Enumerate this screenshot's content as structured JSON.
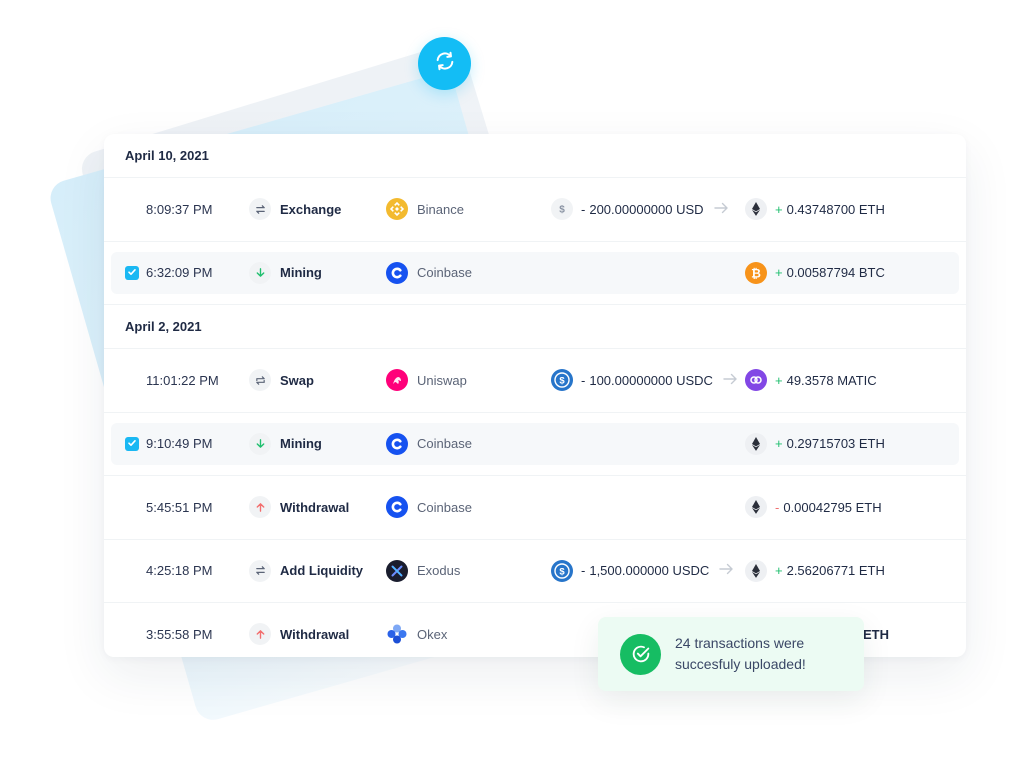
{
  "refresh_button": {
    "icon": "refresh-icon",
    "color": "#13bdf5"
  },
  "groups": [
    {
      "date": "April 10, 2021",
      "rows": [
        {
          "selected": false,
          "time": "8:09:37 PM",
          "type": {
            "label": "Exchange",
            "icon": "exchange-icon"
          },
          "exchange": {
            "name": "Binance",
            "icon": "binance-logo",
            "color": "#f3ba2f"
          },
          "sent": {
            "sign": "-",
            "amount": "200.00000000 USD",
            "icon": "dollar-icon"
          },
          "received": {
            "sign": "+",
            "amount": "0.43748700 ETH",
            "icon": "ethereum-icon"
          }
        },
        {
          "selected": true,
          "time": "6:32:09 PM",
          "type": {
            "label": "Mining",
            "icon": "arrow-down-icon"
          },
          "exchange": {
            "name": "Coinbase",
            "icon": "coinbase-logo",
            "color": "#1652f0"
          },
          "sent": null,
          "received": {
            "sign": "+",
            "amount": "0.00587794 BTC",
            "icon": "bitcoin-icon"
          }
        }
      ]
    },
    {
      "date": "April 2, 2021",
      "rows": [
        {
          "selected": false,
          "time": "11:01:22 PM",
          "type": {
            "label": "Swap",
            "icon": "swap-icon"
          },
          "exchange": {
            "name": "Uniswap",
            "icon": "uniswap-logo",
            "color": "#ff007a"
          },
          "sent": {
            "sign": "-",
            "amount": "100.00000000 USDC",
            "icon": "usdc-icon"
          },
          "received": {
            "sign": "+",
            "amount": "49.3578 MATIC",
            "icon": "polygon-icon"
          }
        },
        {
          "selected": true,
          "time": "9:10:49 PM",
          "type": {
            "label": "Mining",
            "icon": "arrow-down-icon"
          },
          "exchange": {
            "name": "Coinbase",
            "icon": "coinbase-logo",
            "color": "#1652f0"
          },
          "sent": null,
          "received": {
            "sign": "+",
            "amount": "0.29715703 ETH",
            "icon": "ethereum-icon"
          }
        },
        {
          "selected": false,
          "time": "5:45:51 PM",
          "type": {
            "label": "Withdrawal",
            "icon": "arrow-up-icon"
          },
          "exchange": {
            "name": "Coinbase",
            "icon": "coinbase-logo",
            "color": "#1652f0"
          },
          "sent": null,
          "received": {
            "sign": "-",
            "amount": "0.00042795 ETH",
            "icon": "ethereum-icon"
          }
        },
        {
          "selected": false,
          "time": "4:25:18 PM",
          "type": {
            "label": "Add Liquidity",
            "icon": "exchange-icon"
          },
          "exchange": {
            "name": "Exodus",
            "icon": "exodus-logo",
            "color": "#1a1d2e"
          },
          "sent": {
            "sign": "-",
            "amount": "1,500.000000 USDC",
            "icon": "usdc-icon"
          },
          "received": {
            "sign": "+",
            "amount": "2.56206771 ETH",
            "icon": "ethereum-icon"
          }
        },
        {
          "selected": false,
          "time": "3:55:58 PM",
          "type": {
            "label": "Withdrawal",
            "icon": "arrow-up-icon"
          },
          "exchange": {
            "name": "Okex",
            "icon": "okex-logo",
            "color": "#3075ee"
          },
          "sent": null,
          "received": {
            "sign": "",
            "amount": "ETH",
            "icon": "ethereum-icon"
          }
        }
      ]
    }
  ],
  "toast": {
    "line1": "24 transactions were",
    "line2": "succesfuly uploaded!",
    "icon": "check-circle-icon",
    "color": "#16bd63"
  }
}
